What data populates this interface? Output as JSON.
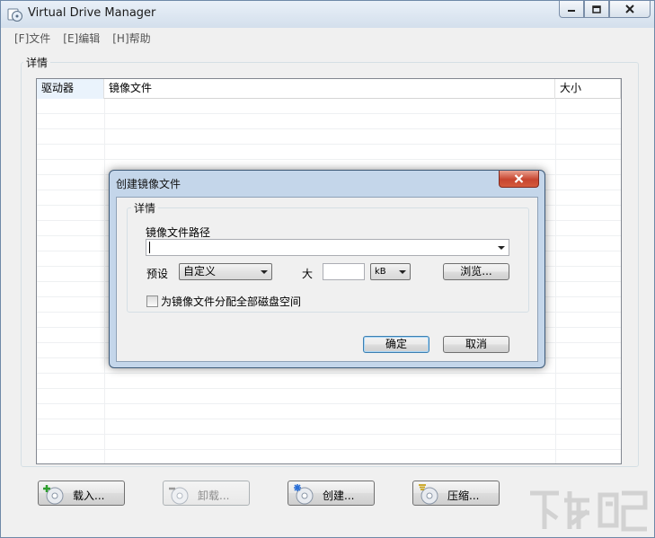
{
  "window": {
    "title": "Virtual Drive Manager",
    "controls": [
      "minimize",
      "maximize",
      "close"
    ]
  },
  "menu": {
    "items": [
      "[F]文件",
      "[E]编辑",
      "[H]帮助"
    ]
  },
  "main": {
    "group_label": "详情",
    "columns": [
      "驱动器",
      "镜像文件",
      "大小"
    ],
    "rows": []
  },
  "toolbar": {
    "load_label": "载入...",
    "unload_label": "卸载...",
    "create_label": "创建...",
    "compress_label": "压缩..."
  },
  "dialog": {
    "title": "创建镜像文件",
    "group_label": "详情",
    "path_label": "镜像文件路径",
    "path_value": "",
    "preset_label": "预设",
    "preset_value": "自定义",
    "size_label": "大",
    "size_value": "",
    "unit_value": "kB",
    "browse_label": "浏览...",
    "allocate_label": "为镜像文件分配全部磁盘空间",
    "allocate_checked": false,
    "ok_label": "确定",
    "cancel_label": "取消"
  },
  "colors": {
    "accent_green": "#2e9e2e",
    "accent_blue": "#2b6fd6",
    "accent_yellow": "#c8a21a"
  }
}
